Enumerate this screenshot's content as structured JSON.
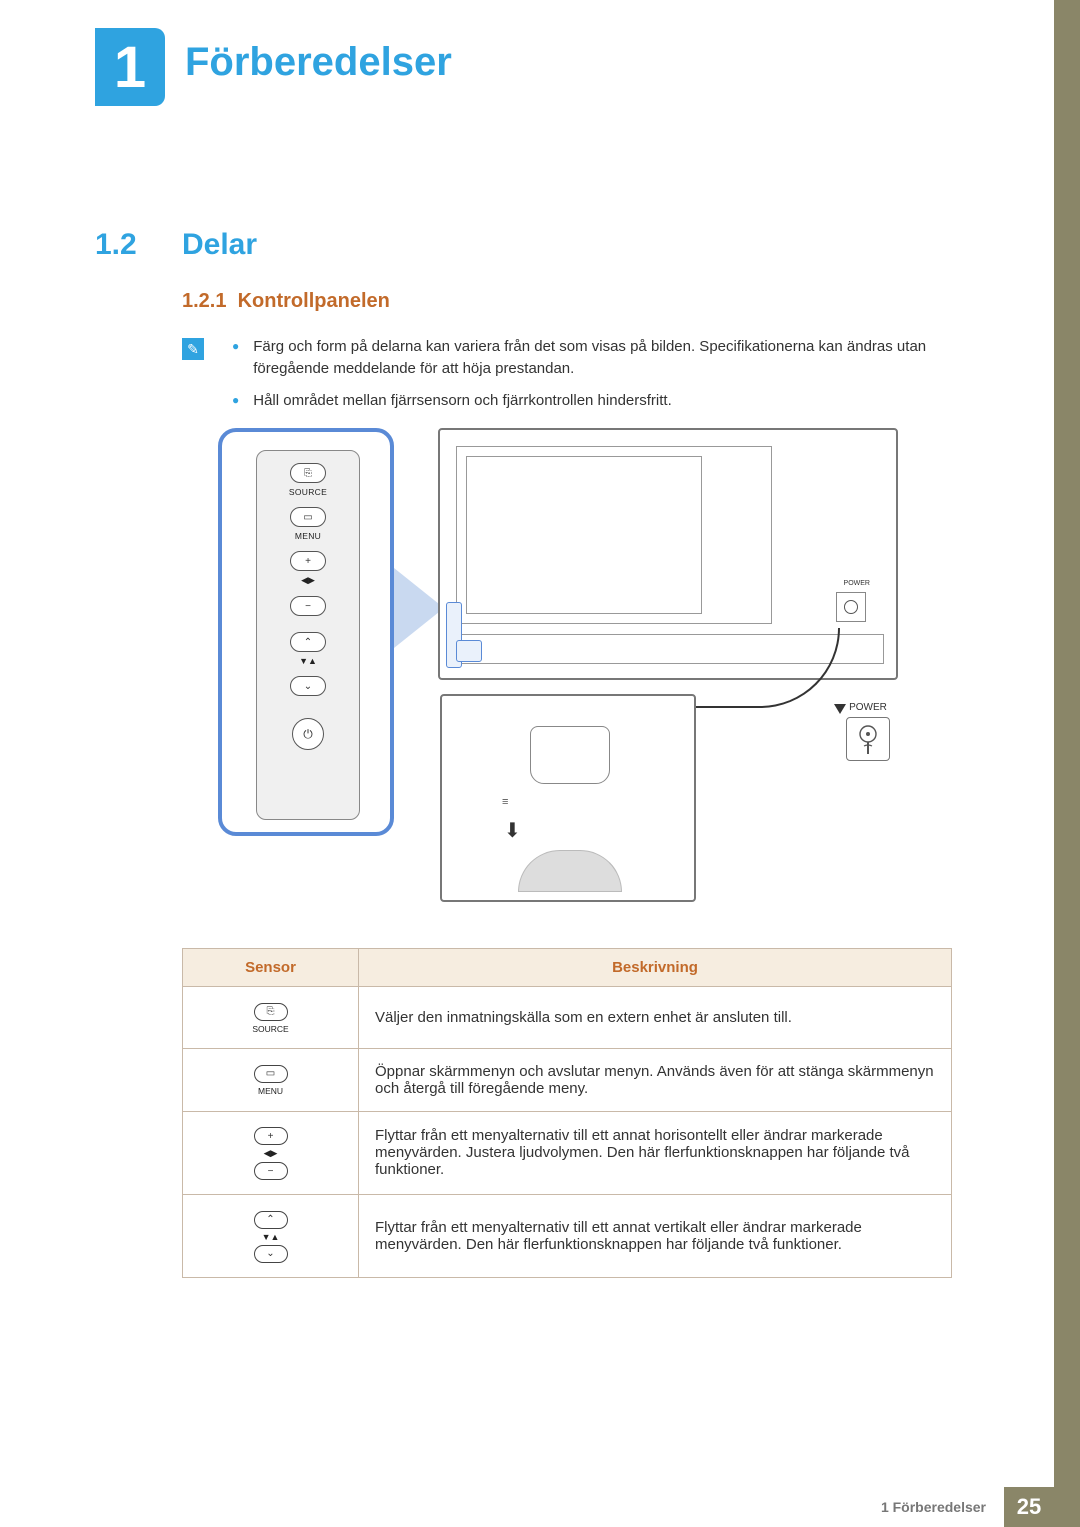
{
  "chapter": {
    "number": "1",
    "title": "Förberedelser"
  },
  "section": {
    "number": "1.2",
    "title": "Delar"
  },
  "subsection": {
    "number": "1.2.1",
    "title": "Kontrollpanelen"
  },
  "notes": [
    "Färg och form på delarna kan variera från det som visas på bilden. Specifikationerna kan ändras utan föregående meddelande för att höja prestandan.",
    "Håll området mellan fjärrsensorn och fjärrkontrollen hindersfritt."
  ],
  "diagram": {
    "panel_labels": {
      "source": "SOURCE",
      "menu": "MENU",
      "power": "POWER"
    },
    "symbols": {
      "source": "⎘",
      "menu": "▭",
      "plus": "+",
      "minus": "−",
      "up": "⌃",
      "down": "⌄",
      "power": "⏻",
      "lr": "◀▶",
      "ud": "▼▲"
    }
  },
  "table": {
    "headers": {
      "sensor": "Sensor",
      "description": "Beskrivning"
    },
    "rows": [
      {
        "icon": "source",
        "desc": "Väljer den inmatningskälla som en extern enhet är ansluten till."
      },
      {
        "icon": "menu",
        "desc": "Öppnar skärmmenyn och avslutar menyn. Används även för att stänga skärmmenyn och återgå till föregående meny."
      },
      {
        "icon": "plusminus",
        "desc": "Flyttar från ett menyalternativ till ett annat horisontellt eller ändrar markerade menyvärden. Justera ljudvolymen. Den här flerfunktionsknappen har följande två funktioner."
      },
      {
        "icon": "updown",
        "desc": "Flyttar från ett menyalternativ till ett annat vertikalt eller ändrar markerade menyvärden. Den här flerfunktionsknappen har följande två funktioner."
      }
    ]
  },
  "footer": {
    "text": "1 Förberedelser",
    "page": "25"
  }
}
